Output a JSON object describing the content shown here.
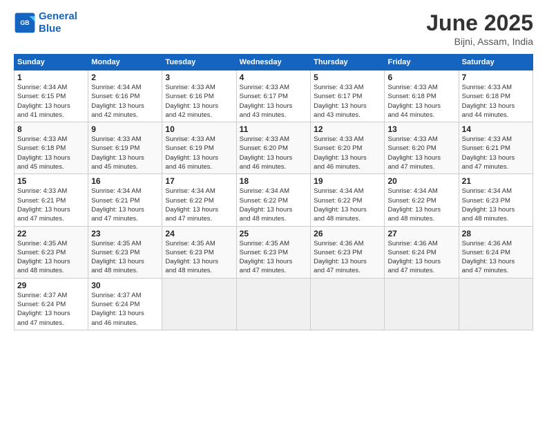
{
  "logo": {
    "line1": "General",
    "line2": "Blue"
  },
  "title": "June 2025",
  "location": "Bijni, Assam, India",
  "days_header": [
    "Sunday",
    "Monday",
    "Tuesday",
    "Wednesday",
    "Thursday",
    "Friday",
    "Saturday"
  ],
  "weeks": [
    [
      {
        "day": "1",
        "sunrise": "4:34 AM",
        "sunset": "6:15 PM",
        "daylight": "13 hours and 41 minutes."
      },
      {
        "day": "2",
        "sunrise": "4:34 AM",
        "sunset": "6:16 PM",
        "daylight": "13 hours and 42 minutes."
      },
      {
        "day": "3",
        "sunrise": "4:33 AM",
        "sunset": "6:16 PM",
        "daylight": "13 hours and 42 minutes."
      },
      {
        "day": "4",
        "sunrise": "4:33 AM",
        "sunset": "6:17 PM",
        "daylight": "13 hours and 43 minutes."
      },
      {
        "day": "5",
        "sunrise": "4:33 AM",
        "sunset": "6:17 PM",
        "daylight": "13 hours and 43 minutes."
      },
      {
        "day": "6",
        "sunrise": "4:33 AM",
        "sunset": "6:18 PM",
        "daylight": "13 hours and 44 minutes."
      },
      {
        "day": "7",
        "sunrise": "4:33 AM",
        "sunset": "6:18 PM",
        "daylight": "13 hours and 44 minutes."
      }
    ],
    [
      {
        "day": "8",
        "sunrise": "4:33 AM",
        "sunset": "6:18 PM",
        "daylight": "13 hours and 45 minutes."
      },
      {
        "day": "9",
        "sunrise": "4:33 AM",
        "sunset": "6:19 PM",
        "daylight": "13 hours and 45 minutes."
      },
      {
        "day": "10",
        "sunrise": "4:33 AM",
        "sunset": "6:19 PM",
        "daylight": "13 hours and 46 minutes."
      },
      {
        "day": "11",
        "sunrise": "4:33 AM",
        "sunset": "6:20 PM",
        "daylight": "13 hours and 46 minutes."
      },
      {
        "day": "12",
        "sunrise": "4:33 AM",
        "sunset": "6:20 PM",
        "daylight": "13 hours and 46 minutes."
      },
      {
        "day": "13",
        "sunrise": "4:33 AM",
        "sunset": "6:20 PM",
        "daylight": "13 hours and 47 minutes."
      },
      {
        "day": "14",
        "sunrise": "4:33 AM",
        "sunset": "6:21 PM",
        "daylight": "13 hours and 47 minutes."
      }
    ],
    [
      {
        "day": "15",
        "sunrise": "4:33 AM",
        "sunset": "6:21 PM",
        "daylight": "13 hours and 47 minutes."
      },
      {
        "day": "16",
        "sunrise": "4:34 AM",
        "sunset": "6:21 PM",
        "daylight": "13 hours and 47 minutes."
      },
      {
        "day": "17",
        "sunrise": "4:34 AM",
        "sunset": "6:22 PM",
        "daylight": "13 hours and 47 minutes."
      },
      {
        "day": "18",
        "sunrise": "4:34 AM",
        "sunset": "6:22 PM",
        "daylight": "13 hours and 48 minutes."
      },
      {
        "day": "19",
        "sunrise": "4:34 AM",
        "sunset": "6:22 PM",
        "daylight": "13 hours and 48 minutes."
      },
      {
        "day": "20",
        "sunrise": "4:34 AM",
        "sunset": "6:22 PM",
        "daylight": "13 hours and 48 minutes."
      },
      {
        "day": "21",
        "sunrise": "4:34 AM",
        "sunset": "6:23 PM",
        "daylight": "13 hours and 48 minutes."
      }
    ],
    [
      {
        "day": "22",
        "sunrise": "4:35 AM",
        "sunset": "6:23 PM",
        "daylight": "13 hours and 48 minutes."
      },
      {
        "day": "23",
        "sunrise": "4:35 AM",
        "sunset": "6:23 PM",
        "daylight": "13 hours and 48 minutes."
      },
      {
        "day": "24",
        "sunrise": "4:35 AM",
        "sunset": "6:23 PM",
        "daylight": "13 hours and 48 minutes."
      },
      {
        "day": "25",
        "sunrise": "4:35 AM",
        "sunset": "6:23 PM",
        "daylight": "13 hours and 47 minutes."
      },
      {
        "day": "26",
        "sunrise": "4:36 AM",
        "sunset": "6:23 PM",
        "daylight": "13 hours and 47 minutes."
      },
      {
        "day": "27",
        "sunrise": "4:36 AM",
        "sunset": "6:24 PM",
        "daylight": "13 hours and 47 minutes."
      },
      {
        "day": "28",
        "sunrise": "4:36 AM",
        "sunset": "6:24 PM",
        "daylight": "13 hours and 47 minutes."
      }
    ],
    [
      {
        "day": "29",
        "sunrise": "4:37 AM",
        "sunset": "6:24 PM",
        "daylight": "13 hours and 47 minutes."
      },
      {
        "day": "30",
        "sunrise": "4:37 AM",
        "sunset": "6:24 PM",
        "daylight": "13 hours and 46 minutes."
      },
      null,
      null,
      null,
      null,
      null
    ]
  ],
  "labels": {
    "sunrise": "Sunrise:",
    "sunset": "Sunset:",
    "daylight": "Daylight: 13 hours"
  }
}
